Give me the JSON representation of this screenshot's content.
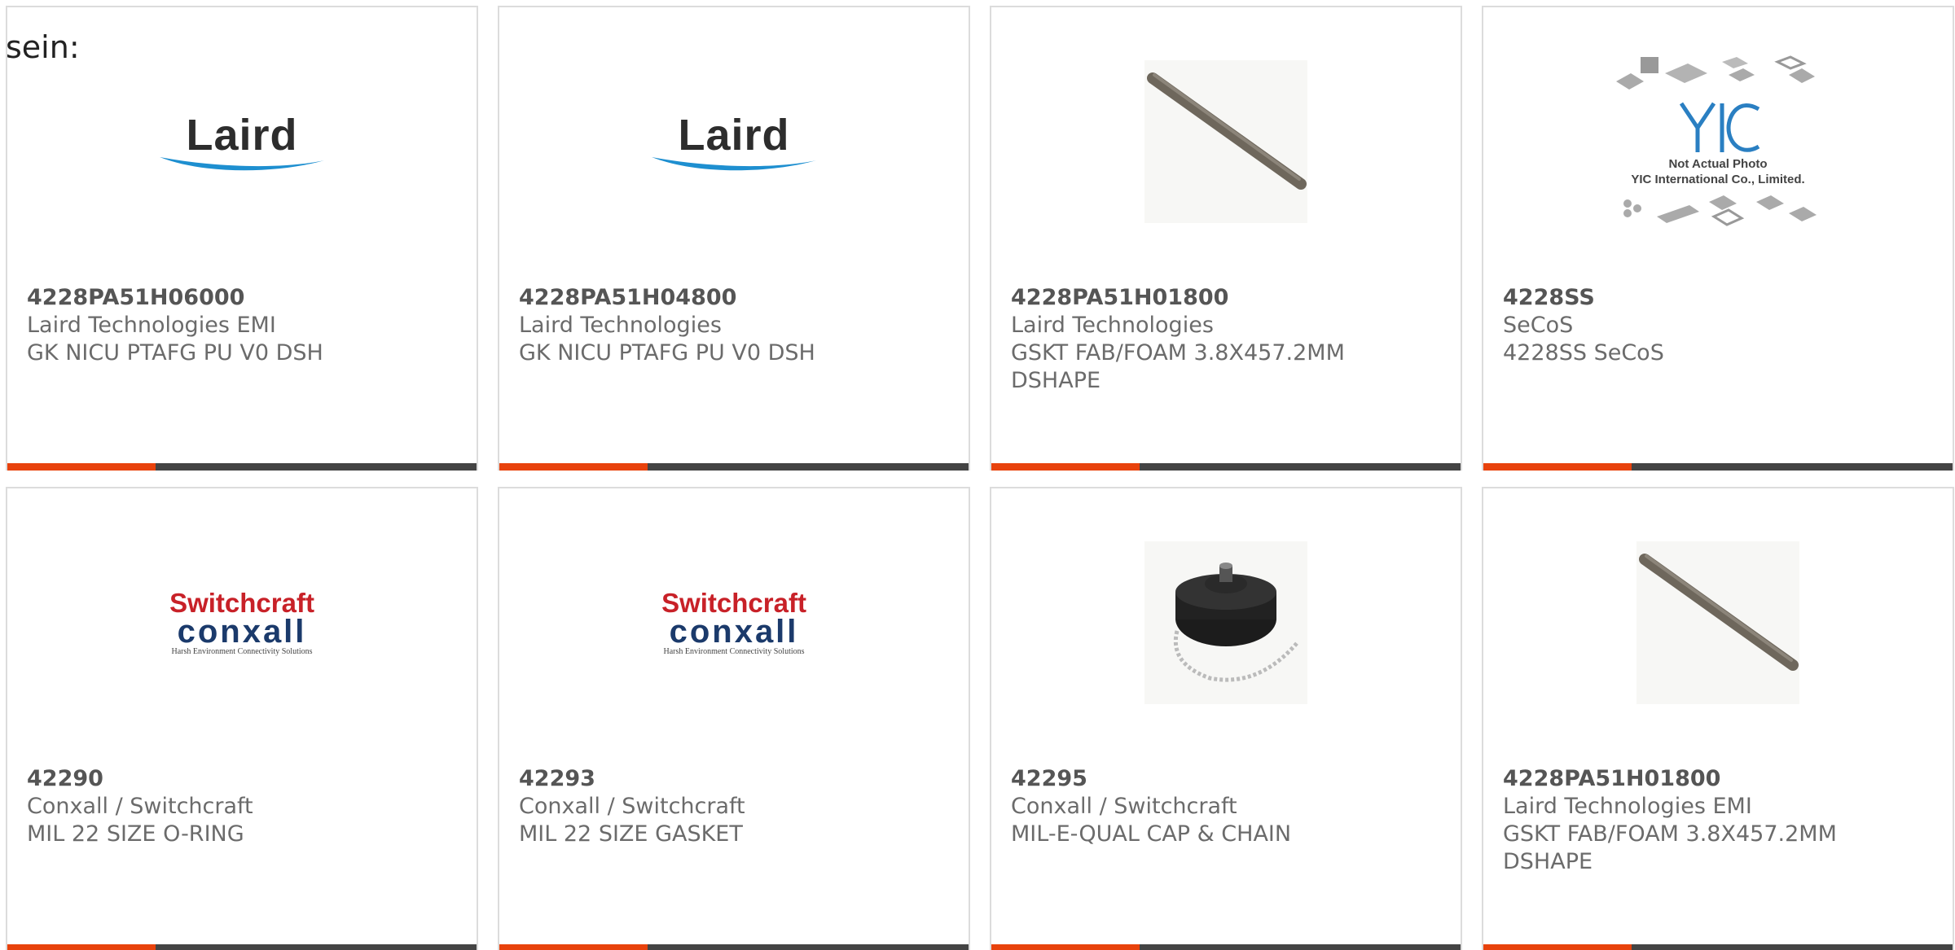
{
  "header": {
    "title": "sein:"
  },
  "colors": {
    "accent": "#e8420c",
    "bar": "#444444",
    "border": "#dcdcdc",
    "text": "#6b6b6b"
  },
  "products": [
    {
      "part_number": "4228PA51H06000",
      "manufacturer": "Laird Technologies EMI",
      "description": "GK NICU PTAFG PU V0 DSH",
      "image": "laird-logo",
      "image_text": "Laird"
    },
    {
      "part_number": "4228PA51H04800",
      "manufacturer": "Laird Technologies",
      "description": "GK NICU PTAFG PU V0 DSH",
      "image": "laird-logo",
      "image_text": "Laird"
    },
    {
      "part_number": "4228PA51H01800",
      "manufacturer": "Laird Technologies",
      "description": "GSKT FAB/FOAM 3.8X457.2MM DSHAPE",
      "image": "gasket-rod-photo"
    },
    {
      "part_number": "4228SS",
      "manufacturer": "SeCoS",
      "description": "4228SS SeCoS",
      "image": "yic-placeholder",
      "image_note": [
        "Not Actual Photo",
        "YIC International Co., Limited."
      ]
    },
    {
      "part_number": "42290",
      "manufacturer": "Conxall / Switchcraft",
      "description": "MIL 22 SIZE O-RING",
      "image": "switchcraft-logo",
      "image_text_top": "Switchcraft",
      "image_text_mid": "conxall",
      "image_text_sub": "Harsh Environment Connectivity Solutions"
    },
    {
      "part_number": "42293",
      "manufacturer": "Conxall / Switchcraft",
      "description": "MIL 22 SIZE GASKET",
      "image": "switchcraft-logo",
      "image_text_top": "Switchcraft",
      "image_text_mid": "conxall",
      "image_text_sub": "Harsh Environment Connectivity Solutions"
    },
    {
      "part_number": "42295",
      "manufacturer": "Conxall / Switchcraft",
      "description": "MIL-E-QUAL CAP & CHAIN",
      "image": "cap-chain-photo"
    },
    {
      "part_number": "4228PA51H01800",
      "manufacturer": "Laird Technologies EMI",
      "description": "GSKT FAB/FOAM 3.8X457.2MM DSHAPE",
      "image": "gasket-rod-photo"
    }
  ]
}
